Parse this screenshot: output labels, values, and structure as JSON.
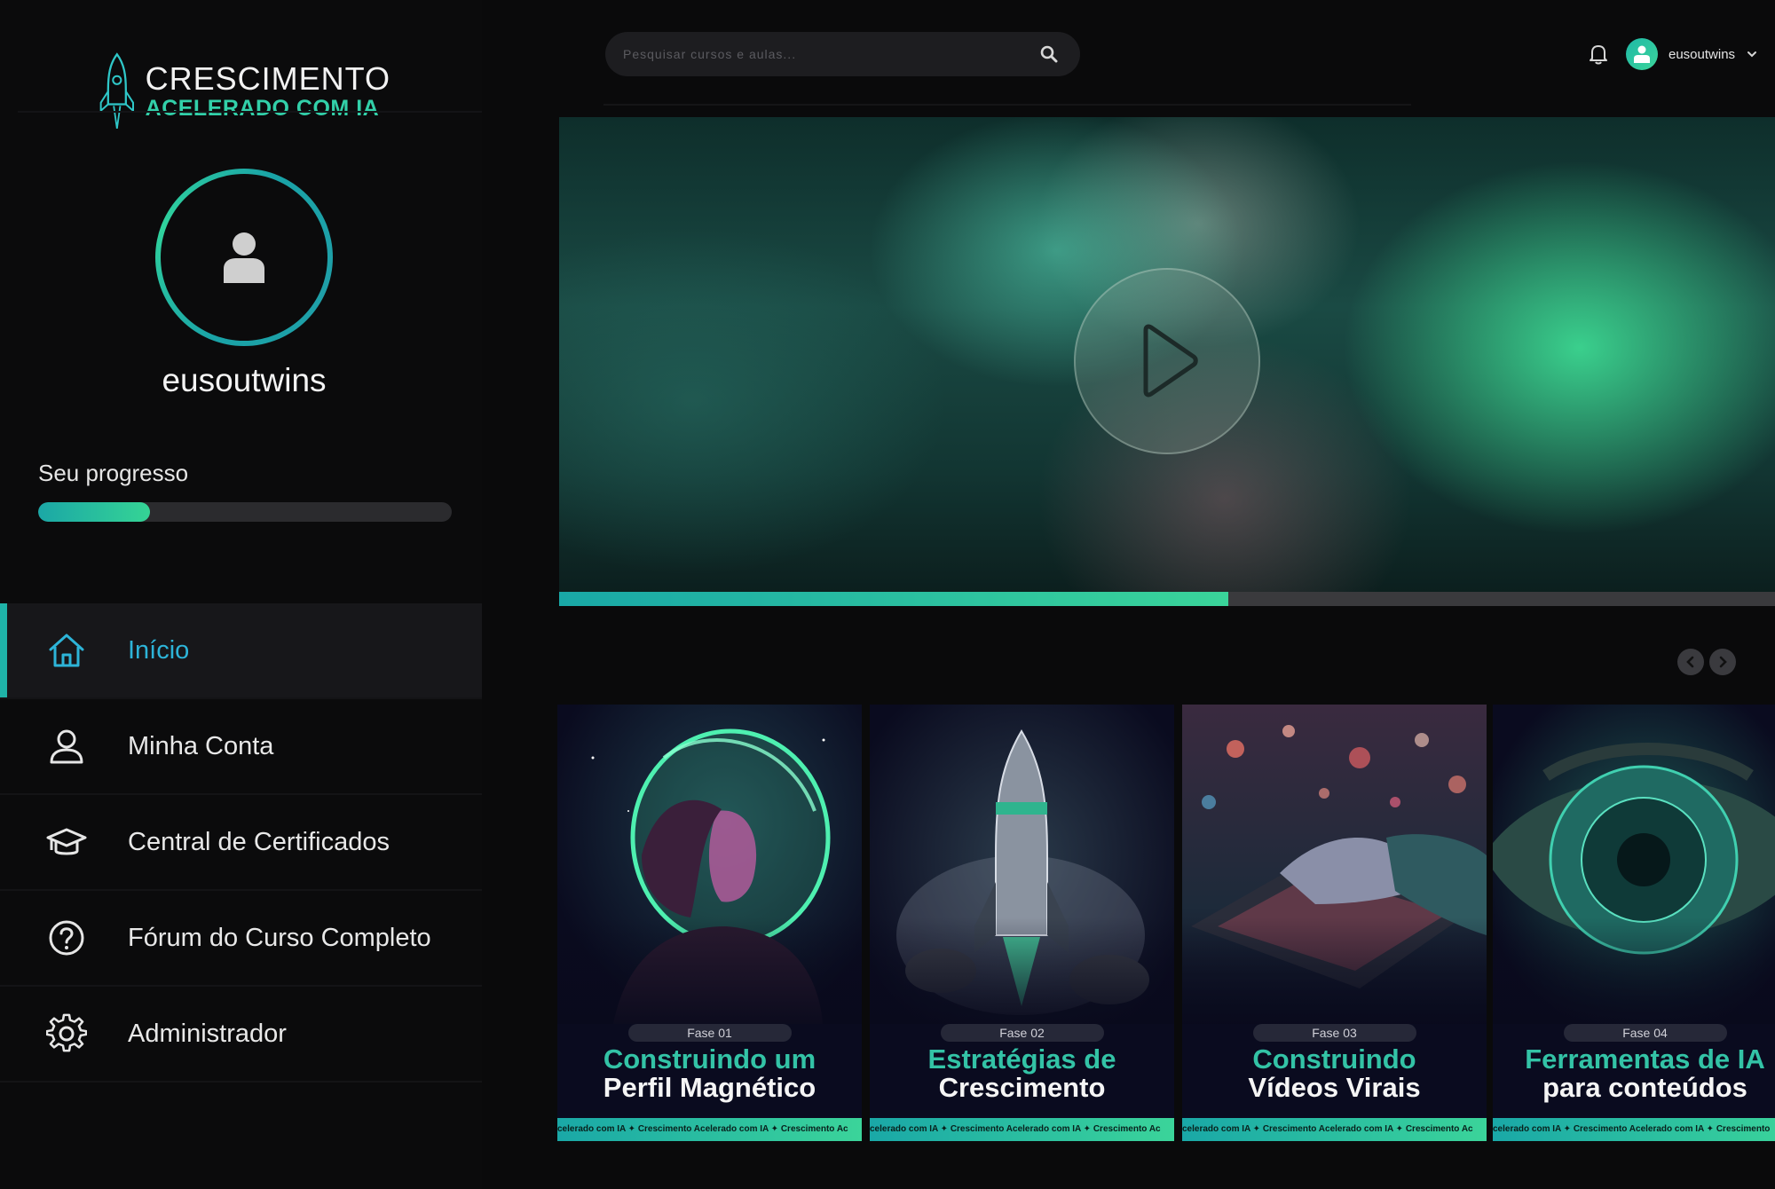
{
  "brand": {
    "line1": "CRESCIMENTO",
    "line2": "ACELERADO COM IA"
  },
  "profile": {
    "username": "eusoutwins",
    "progress_label": "Seu progresso",
    "progress_fraction": 0.27
  },
  "nav": {
    "items": [
      {
        "label": "Início",
        "icon": "home-icon",
        "active": true
      },
      {
        "label": "Minha Conta",
        "icon": "user-icon",
        "active": false
      },
      {
        "label": "Central de Certificados",
        "icon": "graduation-cap-icon",
        "active": false
      },
      {
        "label": "Fórum do Curso Completo",
        "icon": "question-circle-icon",
        "active": false
      },
      {
        "label": "Administrador",
        "icon": "gear-icon",
        "active": false
      }
    ]
  },
  "search": {
    "placeholder": "Pesquisar cursos e aulas..."
  },
  "header": {
    "username": "eusoutwins"
  },
  "hero": {
    "progress_fraction": 0.55
  },
  "courses": [
    {
      "phase": "Fase 01",
      "title_line1": "Construindo um",
      "title_line2": "Perfil Magnético",
      "ribbon": "celerado com IA ✦ Crescimento Acelerado com IA ✦ Crescimento Ac"
    },
    {
      "phase": "Fase 02",
      "title_line1": "Estratégias de",
      "title_line2": "Crescimento",
      "ribbon": "celerado com IA ✦ Crescimento Acelerado com IA ✦ Crescimento Ac"
    },
    {
      "phase": "Fase 03",
      "title_line1": "Construindo",
      "title_line2": "Vídeos Virais",
      "ribbon": "celerado com IA ✦ Crescimento Acelerado com IA ✦ Crescimento Ac"
    },
    {
      "phase": "Fase 04",
      "title_line1": "Ferramentas de IA",
      "title_line2": "para conteúdos",
      "ribbon": "celerado com IA ✦ Crescimento Acelerado com IA ✦ Crescimento"
    }
  ],
  "colors": {
    "accent": "#32d0a9",
    "accent_blue": "#2db4d8",
    "sidebar_bg": "#0b0b0c",
    "page_bg": "#0a0a0b"
  }
}
